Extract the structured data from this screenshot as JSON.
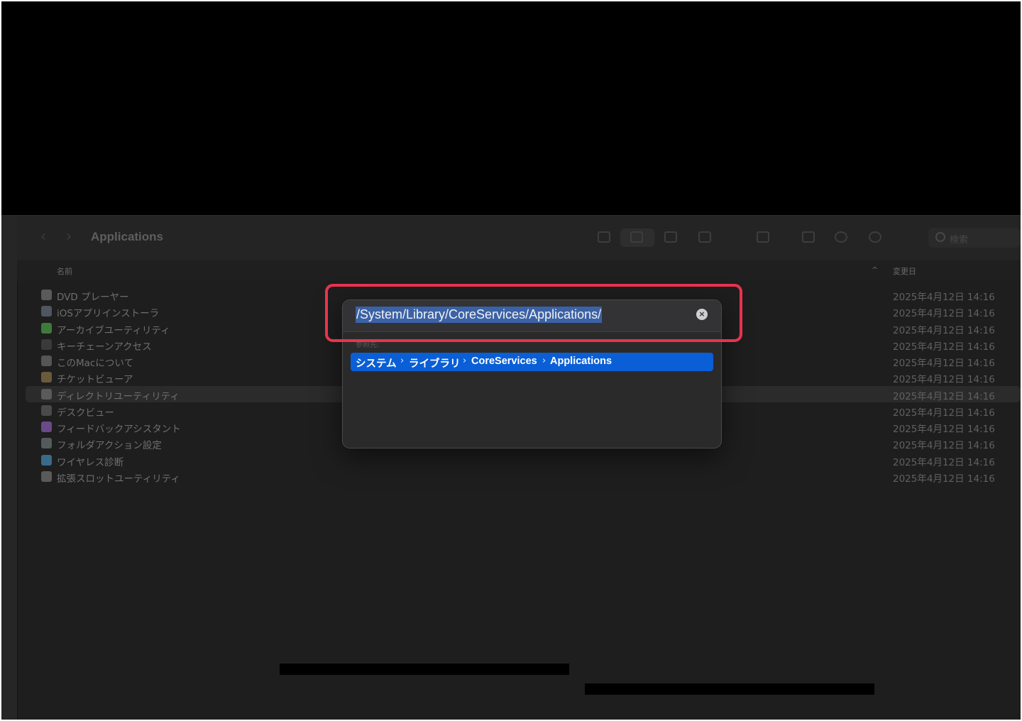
{
  "window": {
    "title": "Applications",
    "search_placeholder": "検索"
  },
  "columns": {
    "name": "名前",
    "sort_indicator": "^",
    "date": "変更日"
  },
  "rows": [
    {
      "name": "DVD プレーヤー",
      "date": "2025年4月12日 14:16",
      "icon_color": "#5a5a5a"
    },
    {
      "name": "iOSアプリインストーラ",
      "date": "2025年4月12日 14:16",
      "icon_color": "#4f5660"
    },
    {
      "name": "アーカイブユーティリティ",
      "date": "2025年4月12日 14:16",
      "icon_color": "#3f7a3a"
    },
    {
      "name": "キーチェーンアクセス",
      "date": "2025年4月12日 14:16",
      "icon_color": "#3a3a3a"
    },
    {
      "name": "このMacについて",
      "date": "2025年4月12日 14:16",
      "icon_color": "#555555"
    },
    {
      "name": "チケットビューア",
      "date": "2025年4月12日 14:16",
      "icon_color": "#6b5a3a"
    },
    {
      "name": "ディレクトリユーティリティ",
      "date": "2025年4月12日 14:16",
      "icon_color": "#5a5a5a"
    },
    {
      "name": "デスクビュー",
      "date": "2025年4月12日 14:16",
      "icon_color": "#4a4a4a"
    },
    {
      "name": "フィードバックアシスタント",
      "date": "2025年4月12日 14:16",
      "icon_color": "#6a4a8a"
    },
    {
      "name": "フォルダアクション設定",
      "date": "2025年4月12日 14:16",
      "icon_color": "#555a5a"
    },
    {
      "name": "ワイヤレス診断",
      "date": "2025年4月12日 14:16",
      "icon_color": "#3a6a8a"
    },
    {
      "name": "拡張スロットユーティリティ",
      "date": "2025年4月12日 14:16",
      "icon_color": "#5a5a5a"
    }
  ],
  "goto_sheet": {
    "path": "/System/Library/CoreServices/Applications/",
    "clear_glyph": "×",
    "reference_label": "参照先:",
    "suggestion": [
      "システム",
      "ライブラリ",
      "CoreServices",
      "Applications"
    ],
    "separator": "›"
  },
  "colors": {
    "highlight": "#e8334e",
    "selection": "#0a5fd6"
  }
}
